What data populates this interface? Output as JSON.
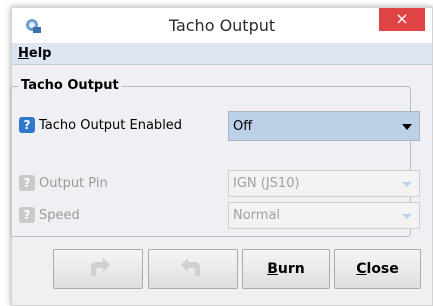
{
  "window": {
    "title": "Tacho Output",
    "close_glyph": "×"
  },
  "menu": {
    "help": {
      "mnemonic": "H",
      "rest": "elp"
    }
  },
  "group": {
    "title": "Tacho Output"
  },
  "fields": {
    "enabled": {
      "label": "Tacho Output Enabled",
      "value": "Off",
      "help_glyph": "?"
    },
    "output_pin": {
      "label": "Output Pin",
      "value": "IGN (JS10)",
      "help_glyph": "?"
    },
    "speed": {
      "label": "Speed",
      "value": "Normal",
      "help_glyph": "?"
    }
  },
  "buttons": {
    "burn": {
      "mnemonic": "B",
      "rest": "urn"
    },
    "close": {
      "mnemonic": "C",
      "rest": "lose"
    }
  },
  "icons": {
    "app": "app-icon",
    "undo": "undo-arrow-icon",
    "redo": "redo-arrow-icon",
    "help": "help-question-icon"
  },
  "colors": {
    "accent_blue": "#2f77c9",
    "close_red": "#e04343",
    "select_highlight": "#bcd0e8"
  }
}
